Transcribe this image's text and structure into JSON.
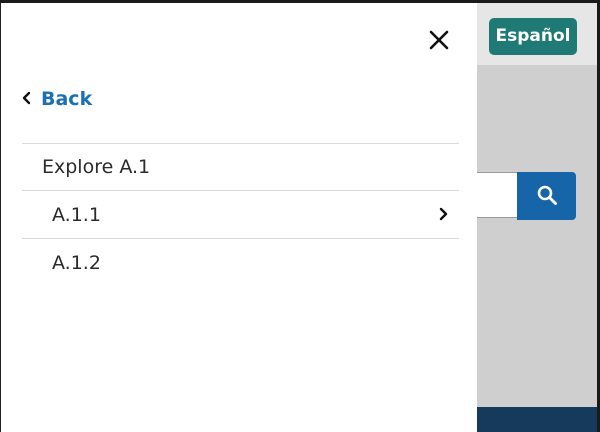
{
  "header": {
    "language_button": "Español"
  },
  "search": {
    "button_icon": "search-icon"
  },
  "drawer": {
    "close_icon": "close-icon",
    "back_label": "Back",
    "section_title": "Explore A.1",
    "items": [
      {
        "label": "A.1.1",
        "has_children": true
      },
      {
        "label": "A.1.2",
        "has_children": false
      }
    ]
  },
  "colors": {
    "accent_link": "#1b6fb3",
    "language_button_bg": "#1f7a76",
    "search_button_bg": "#1565a8",
    "footer_bg": "#163a5c",
    "overlay": "#cfcfcf"
  }
}
